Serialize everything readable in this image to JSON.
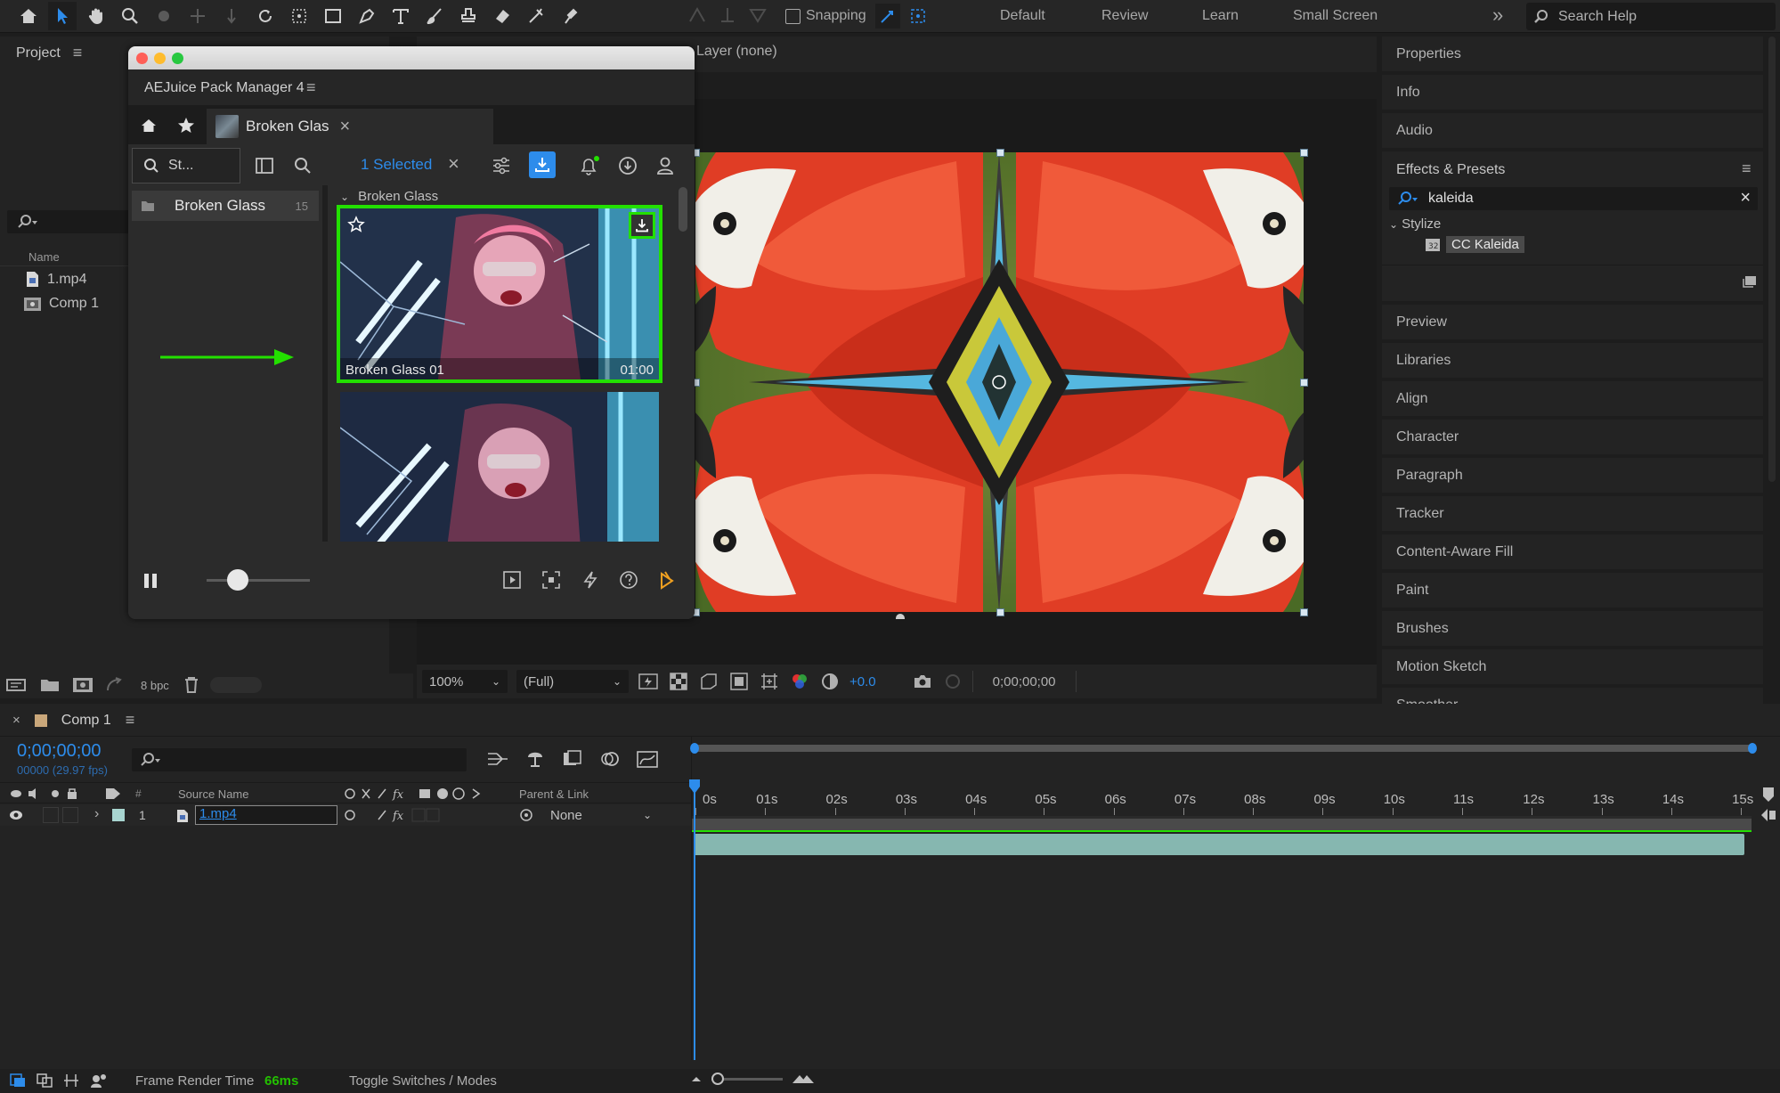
{
  "toolbar": {
    "snapping_label": "Snapping",
    "workspaces": [
      "Default",
      "Review",
      "Learn",
      "Small Screen"
    ],
    "overflow": "»",
    "search_placeholder": "Search Help"
  },
  "project": {
    "title": "Project",
    "column_name": "Name",
    "items": [
      {
        "name": "1.mp4",
        "icon": "footage-icon"
      },
      {
        "name": "Comp 1",
        "icon": "composition-icon"
      }
    ],
    "bpc": "8 bpc"
  },
  "viewer": {
    "layer_label": "Layer (none)",
    "zoom": "100%",
    "resolution": "(Full)",
    "exposure": "+0.0",
    "timecode": "0;00;00;00"
  },
  "aejuice": {
    "title": "AEJuice Pack Manager 4",
    "tab_label": "Broken Glas",
    "search_placeholder": "St...",
    "selected_label": "1 Selected",
    "category": {
      "name": "Broken Glass",
      "count": "15"
    },
    "section_header": "Broken Glass",
    "items": [
      {
        "name": "Broken Glass 01",
        "duration": "01:00",
        "selected": true
      },
      {
        "name": "",
        "duration": "",
        "selected": false
      }
    ],
    "slider_value": 0.3
  },
  "right_panels": {
    "top": [
      "Properties",
      "Info",
      "Audio"
    ],
    "effects": {
      "title": "Effects & Presets",
      "search_value": "kaleida",
      "group": "Stylize",
      "effect": "CC Kaleida"
    },
    "bottom": [
      "Preview",
      "Libraries",
      "Align",
      "Character",
      "Paragraph",
      "Tracker",
      "Content-Aware Fill",
      "Paint",
      "Brushes",
      "Motion Sketch",
      "Smoother"
    ]
  },
  "timeline": {
    "comp_tab": "Comp 1",
    "timecode": "0;00;00;00",
    "frames": "00000 (29.97 fps)",
    "col_hash": "#",
    "col_source": "Source Name",
    "col_parent": "Parent & Link",
    "layer": {
      "index": "1",
      "name": "1.mp4",
      "parent": "None"
    },
    "ticks": [
      "0s",
      "01s",
      "02s",
      "03s",
      "04s",
      "05s",
      "06s",
      "07s",
      "08s",
      "09s",
      "10s",
      "11s",
      "12s",
      "13s",
      "14s",
      "15s"
    ]
  },
  "statusbar": {
    "render_label": "Frame Render Time",
    "render_value": "66ms",
    "toggle_label": "Toggle Switches / Modes"
  },
  "colors": {
    "accent_blue": "#2d8ceb",
    "green_highlight": "#23e000",
    "layer_bar": "#86b7b0"
  }
}
